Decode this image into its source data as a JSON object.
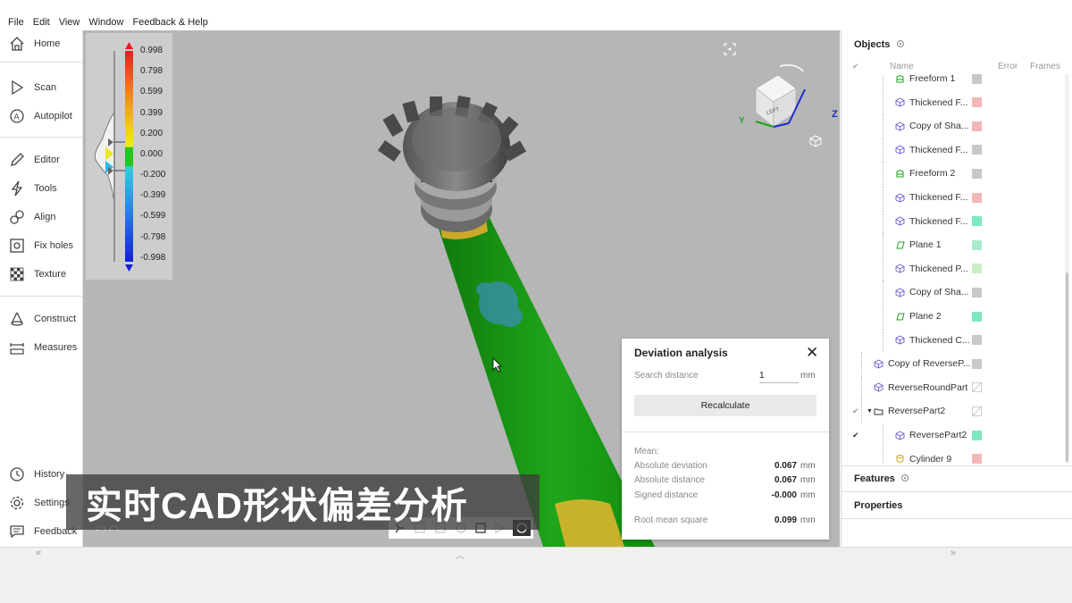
{
  "menu": [
    "File",
    "Edit",
    "View",
    "Window",
    "Feedback & Help"
  ],
  "tools": {
    "home": "Home",
    "scan": "Scan",
    "autopilot": "Autopilot",
    "editor": "Editor",
    "tools": "Tools",
    "align": "Align",
    "fix_holes": "Fix holes",
    "texture": "Texture",
    "construct": "Construct",
    "measures": "Measures",
    "history": "History",
    "settings": "Settings",
    "feedback": "Feedback"
  },
  "legend": {
    "labels": [
      "0.998",
      "0.798",
      "0.599",
      "0.399",
      "0.200",
      "0.000",
      "-0.200",
      "-0.399",
      "-0.599",
      "-0.798",
      "-0.998"
    ]
  },
  "viewcube": {
    "face": "LEFT",
    "axis_y": "Y",
    "axis_z": "Z"
  },
  "objects": {
    "title": "Objects",
    "col_name": "Name",
    "col_error": "Error",
    "col_frames": "Frames",
    "rows": [
      {
        "name": "Freeform 1",
        "color": "#c8c8c8"
      },
      {
        "name": "Thickened F...",
        "color": "#f4b7b7"
      },
      {
        "name": "Copy of Sha...",
        "color": "#f4b7b7"
      },
      {
        "name": "Thickened F...",
        "color": "#c8c8c8"
      },
      {
        "name": "Freeform 2",
        "color": "#c8c8c8"
      },
      {
        "name": "Thickened F...",
        "color": "#f4b7b7"
      },
      {
        "name": "Thickened F...",
        "color": "#7ee8c0"
      },
      {
        "name": "Plane 1",
        "color": "#a8eccc"
      },
      {
        "name": "Thickened P...",
        "color": "#c9f0c4"
      },
      {
        "name": "Copy of Sha...",
        "color": "#c8c8c8"
      },
      {
        "name": "Plane 2",
        "color": "#7ee8c0"
      },
      {
        "name": "Thickened C...",
        "color": "#c8c8c8"
      },
      {
        "name": "Copy of ReverseP...",
        "color": "#c8c8c8"
      },
      {
        "name": "ReverseRoundPart",
        "color": "none"
      },
      {
        "name": "ReversePart2",
        "color": "none"
      },
      {
        "name": "ReversePart2",
        "color": "#7ee8c0"
      },
      {
        "name": "Cylinder 9",
        "color": "#f4b7b7"
      }
    ]
  },
  "features": {
    "title": "Features"
  },
  "properties": {
    "title": "Properties"
  },
  "deviation": {
    "title": "Deviation analysis",
    "search_label": "Search distance",
    "search_value": "1",
    "search_unit": "mm",
    "recalc": "Recalculate",
    "mean_label": "Mean:",
    "abs_dev_label": "Absolute deviation",
    "abs_dev_value": "0.067",
    "abs_dist_label": "Absolute distance",
    "abs_dist_value": "0.067",
    "signed_label": "Signed distance",
    "signed_value": "-0.000",
    "rms_label": "Root mean square",
    "rms_value": "0.099",
    "unit": "mm"
  },
  "subtitle": "实时CAD形状偏差分析",
  "colors": {
    "deviation_green": "#1a9a14",
    "mesh_yellow": "#c9b22b",
    "viewport_bg": "#b6b6b6"
  }
}
